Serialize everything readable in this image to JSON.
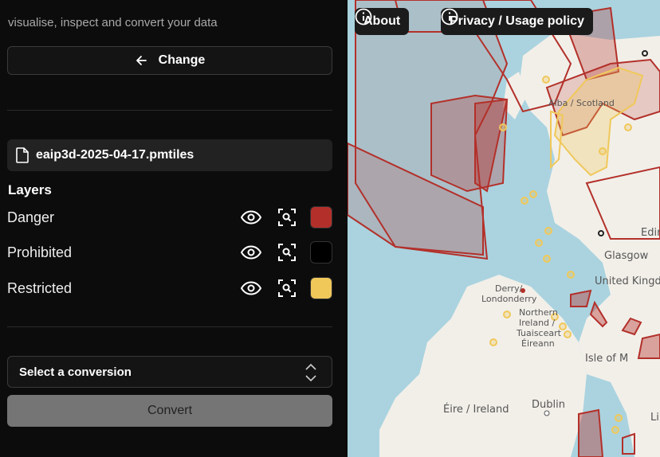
{
  "sidebar": {
    "tagline": "visualise, inspect and convert your data",
    "change_label": "Change",
    "file_name": "eaip3d-2025-04-17.pmtiles",
    "layers_title": "Layers",
    "layers": [
      {
        "name": "Danger",
        "color": "#b3302a"
      },
      {
        "name": "Prohibited",
        "color": "#000000"
      },
      {
        "name": "Restricted",
        "color": "#f0c85a"
      }
    ],
    "conversion_placeholder": "Select a conversion",
    "convert_label": "Convert"
  },
  "map": {
    "about_label": "About",
    "privacy_label": "Privacy / Usage policy",
    "places": {
      "alba": "Alba / Scotland",
      "glasgow": "Glasgow",
      "edinburgh": "Edin",
      "uk": "United Kingd",
      "derry": "Derry/",
      "londonderry": "Londonderry",
      "northern": "Northern",
      "ireland_ni": "Ireland /",
      "tuaisceart": "Tuaisceart",
      "eireann": "Éireann",
      "isle": "Isle of M",
      "dublin": "Dublin",
      "eire": "Éire / Ireland",
      "li": "Li"
    }
  }
}
